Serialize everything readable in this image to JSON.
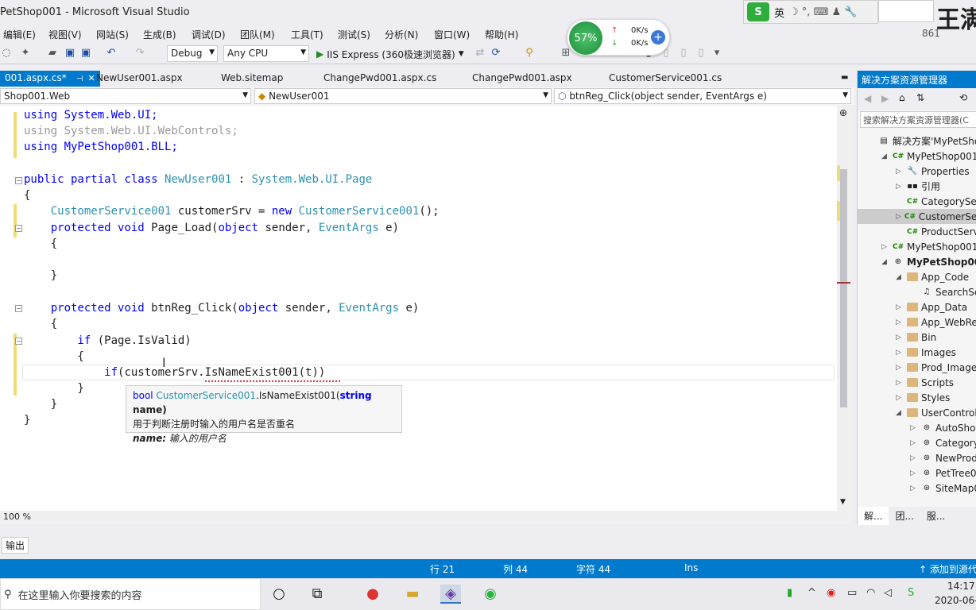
{
  "window": {
    "title": "PetShop001 - Microsoft Visual Studio"
  },
  "ime": {
    "logo": "S",
    "lang": "英",
    "icons": "☽ °, ⌨ ♟ 🔧"
  },
  "watermark": "王满",
  "menu": [
    "编辑(E)",
    "视图(V)",
    "网站(S)",
    "生成(B)",
    "调试(D)",
    "团队(M)",
    "工具(T)",
    "测试(S)",
    "分析(N)",
    "窗口(W)",
    "帮助(H)"
  ],
  "menu_right_text": "861",
  "toolbar": {
    "config": "Debug",
    "platform": "Any CPU",
    "run_label": "IIS Express (360极速浏览器)"
  },
  "net_widget": {
    "percent": "57%",
    "up": "0K/s",
    "down": "0K/s",
    "up_arrow": "↑",
    "down_arrow": "↓",
    "plus": "+"
  },
  "tabs": [
    {
      "label": "001.aspx.cs*",
      "pin": "⊣",
      "close": "✕"
    },
    {
      "label": "NewUser001.aspx"
    },
    {
      "label": "Web.sitemap"
    },
    {
      "label": "ChangePwd001.aspx.cs"
    },
    {
      "label": "ChangePwd001.aspx"
    },
    {
      "label": "CustomerService001.cs"
    }
  ],
  "navbar": {
    "project": "Shop001.Web",
    "class": "NewUser001",
    "member": "btnReg_Click(object sender, EventArgs e)"
  },
  "code": {
    "l1": "using System.Web.UI;",
    "l2": "using System.Web.UI.WebControls;",
    "l3": "using MyPetShop001.BLL;",
    "l5a": "public partial class ",
    "l5b": "NewUser001",
    "l5c": " : ",
    "l5d": "System.Web.UI.Page",
    "l6": "{",
    "l7a": "    ",
    "l7b": "CustomerService001",
    "l7c": " customerSrv = ",
    "l7d": "new",
    "l7e": " ",
    "l7f": "CustomerService001",
    "l7g": "();",
    "l8a": "    protected void ",
    "l8b": "Page_Load(",
    "l8c": "object",
    "l8d": " sender, ",
    "l8e": "EventArgs",
    "l8f": " e)",
    "l9": "    {",
    "l11": "    }",
    "l13a": "    protected void ",
    "l13b": "btnReg_Click(",
    "l13c": "object",
    "l13d": " sender, ",
    "l13e": "EventArgs",
    "l13f": " e)",
    "l14": "    {",
    "l15a": "        if ",
    "l15b": "(Page.IsValid)",
    "l16": "        {",
    "l17a": "            if",
    "l17b": "(customerSrv.IsNameExist001(t))",
    "l18": "        }",
    "l19": "    }",
    "l20": "}"
  },
  "tooltip": {
    "kw": "bool ",
    "type": "CustomerService001",
    "method": ".IsNameExist001(",
    "param_kw": "string",
    "param": " name)",
    "desc": "用于判断注册时输入的用户名是否重名",
    "param_name": "name:",
    "param_desc": " 输入的用户名"
  },
  "zoom": "100 %",
  "solution_explorer": {
    "title": "解决方案资源管理器",
    "search_placeholder": "搜索解决方案资源管理器(C",
    "tree": [
      {
        "label": "解决方案'MyPetShop",
        "indent": 0
      },
      {
        "label": "MyPetShop001.B",
        "indent": 1
      },
      {
        "label": "Properties",
        "indent": 2
      },
      {
        "label": "引用",
        "indent": 2
      },
      {
        "label": "CategoryServi",
        "indent": 2
      },
      {
        "label": "CustomerServ",
        "indent": 2
      },
      {
        "label": "ProductServic",
        "indent": 2
      },
      {
        "label": "MyPetShop001.D",
        "indent": 1
      },
      {
        "label": "MyPetShop001.W",
        "indent": 1
      },
      {
        "label": "App_Code",
        "indent": 2
      },
      {
        "label": "SearchServ",
        "indent": 3
      },
      {
        "label": "App_Data",
        "indent": 2
      },
      {
        "label": "App_WebRefe",
        "indent": 2
      },
      {
        "label": "Bin",
        "indent": 2
      },
      {
        "label": "Images",
        "indent": 2
      },
      {
        "label": "Prod_Images",
        "indent": 2
      },
      {
        "label": "Scripts",
        "indent": 2
      },
      {
        "label": "Styles",
        "indent": 2
      },
      {
        "label": "UserControl",
        "indent": 2
      },
      {
        "label": "AutoShow0",
        "indent": 3
      },
      {
        "label": "Category0",
        "indent": 3
      },
      {
        "label": "NewProdu",
        "indent": 3
      },
      {
        "label": "PetTree001",
        "indent": 3
      },
      {
        "label": "SiteMap00",
        "indent": 3
      }
    ],
    "bottom_tabs": [
      "解...",
      "团...",
      "服...",
      ""
    ]
  },
  "output_tab": "输出",
  "status": {
    "line": "行 21",
    "col": "列 44",
    "char": "字符 44",
    "mode": "Ins",
    "source": "↑  添加到源代"
  },
  "taskbar": {
    "search": "在这里输入你要搜索的内容",
    "time": "14:17",
    "date": "2020-06-"
  }
}
